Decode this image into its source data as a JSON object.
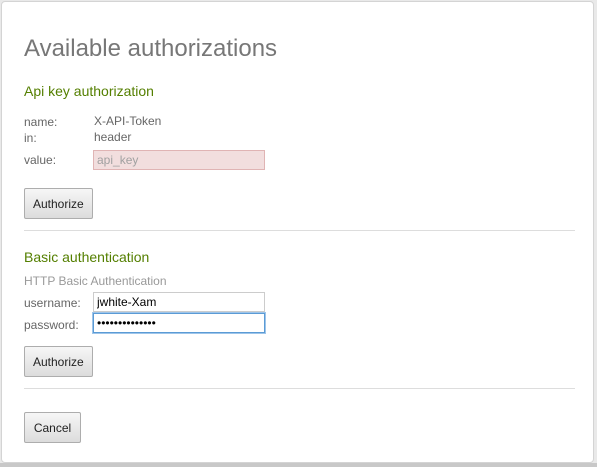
{
  "dialog": {
    "title": "Available authorizations"
  },
  "api_key": {
    "heading": "Api key authorization",
    "name_label": "name:",
    "name_value": "X-API-Token",
    "in_label": "in:",
    "in_value": "header",
    "value_label": "value:",
    "value_placeholder": "api_key",
    "value_current": "",
    "authorize_label": "Authorize"
  },
  "basic_auth": {
    "heading": "Basic authentication",
    "description": "HTTP Basic Authentication",
    "username_label": "username:",
    "username_value": "jwhite-Xam",
    "password_label": "password:",
    "password_value": "••••••••••••••",
    "authorize_label": "Authorize"
  },
  "footer": {
    "cancel_label": "Cancel"
  },
  "colors": {
    "section_heading": "#547f00",
    "title": "#777777",
    "error_field_bg": "#f2dede",
    "focus_border": "#5b9bd5"
  }
}
